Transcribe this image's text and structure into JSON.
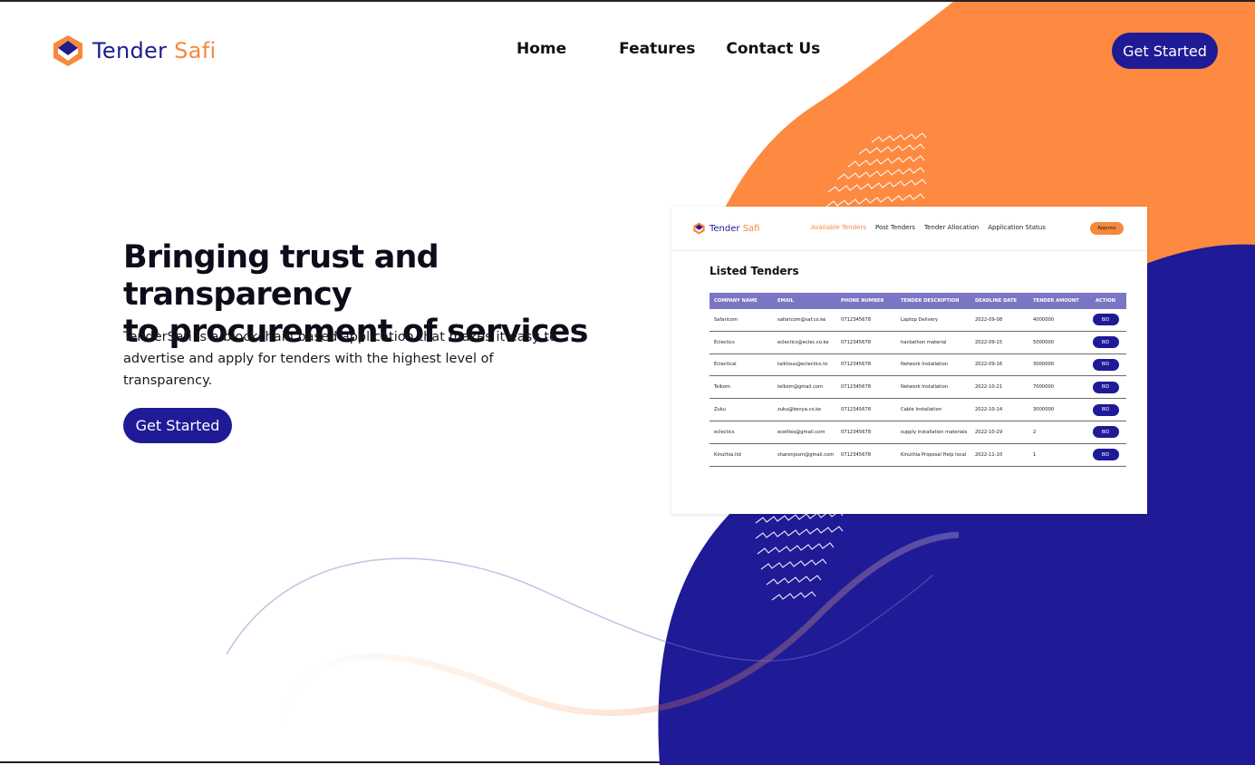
{
  "brand": {
    "name_part1": "Tender",
    "name_part2": "Safi"
  },
  "nav": {
    "home": "Home",
    "features": "Features",
    "contact": "Contact Us"
  },
  "header_cta": "Get Started",
  "hero": {
    "title_line1": "Bringing trust and transparency",
    "title_line2": "to procurement of services",
    "description": "TenderSafi is a blockchain based application that makes it easy to advertise and apply for tenders with the highest level of transparency.",
    "cta": "Get Started"
  },
  "preview": {
    "brand_part1": "Tender",
    "brand_part2": "Safi",
    "nav": [
      "Available Tenders",
      "Post Tenders",
      "Tender Allocation",
      "Application Status"
    ],
    "approve_label": "Approve",
    "section_title": "Listed Tenders",
    "columns": [
      "COMPANY NAME",
      "EMAIL",
      "PHONE NUMBER",
      "TENDER DESCRIPTION",
      "DEADLINE DATE",
      "TENDER AMOUNT",
      "ACTION"
    ],
    "bid_label": "BID",
    "rows": [
      [
        "Safaricom",
        "safaricom@saf.co.ke",
        "0712345678",
        "Laptop Delivery",
        "2022-09-08",
        "4000000"
      ],
      [
        "Eclectics",
        "eclectics@eclec.co.ke",
        "0712345678",
        "hackathon material",
        "2022-09-15",
        "5000000"
      ],
      [
        "Eclectical",
        "talktous@eclectics.to",
        "0712345678",
        "Network Installation",
        "2022-09-16",
        "3000000"
      ],
      [
        "Telkom",
        "telkom@gmail.com",
        "0712345678",
        "Network Installation",
        "2022-10-21",
        "7000000"
      ],
      [
        "Zuku",
        "zuku@kenya.co.ke",
        "0712345678",
        "Cable Installation",
        "2022-10-14",
        "3000000"
      ],
      [
        "eclectics",
        "ecelties@gmail.com",
        "0712345678",
        "supply installation materials",
        "2022-10-29",
        "2"
      ],
      [
        "Kinuthia.ltd",
        "sharonjosm@gmail.com",
        "0712345678",
        "Kinuthia Proposal Help local",
        "2022-11-10",
        "1"
      ]
    ]
  },
  "colors": {
    "navy": "#1f1a96",
    "orange": "#f7883c",
    "table_header": "#7a76c4"
  }
}
